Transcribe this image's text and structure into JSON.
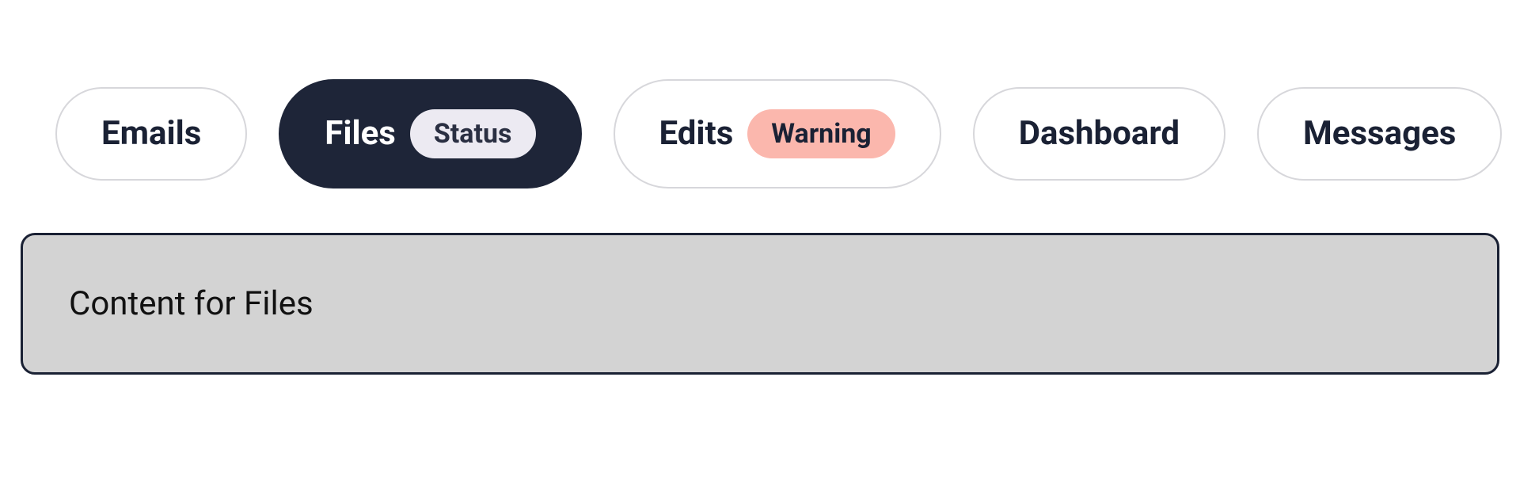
{
  "tabs": {
    "items": [
      {
        "label": "Emails",
        "active": false,
        "badge": null
      },
      {
        "label": "Files",
        "active": true,
        "badge": {
          "text": "Status",
          "variant": "neutral"
        }
      },
      {
        "label": "Edits",
        "active": false,
        "badge": {
          "text": "Warning",
          "variant": "warning"
        }
      },
      {
        "label": "Dashboard",
        "active": false,
        "badge": null
      },
      {
        "label": "Messages",
        "active": false,
        "badge": null
      }
    ]
  },
  "panel": {
    "content_text": "Content for Files"
  }
}
